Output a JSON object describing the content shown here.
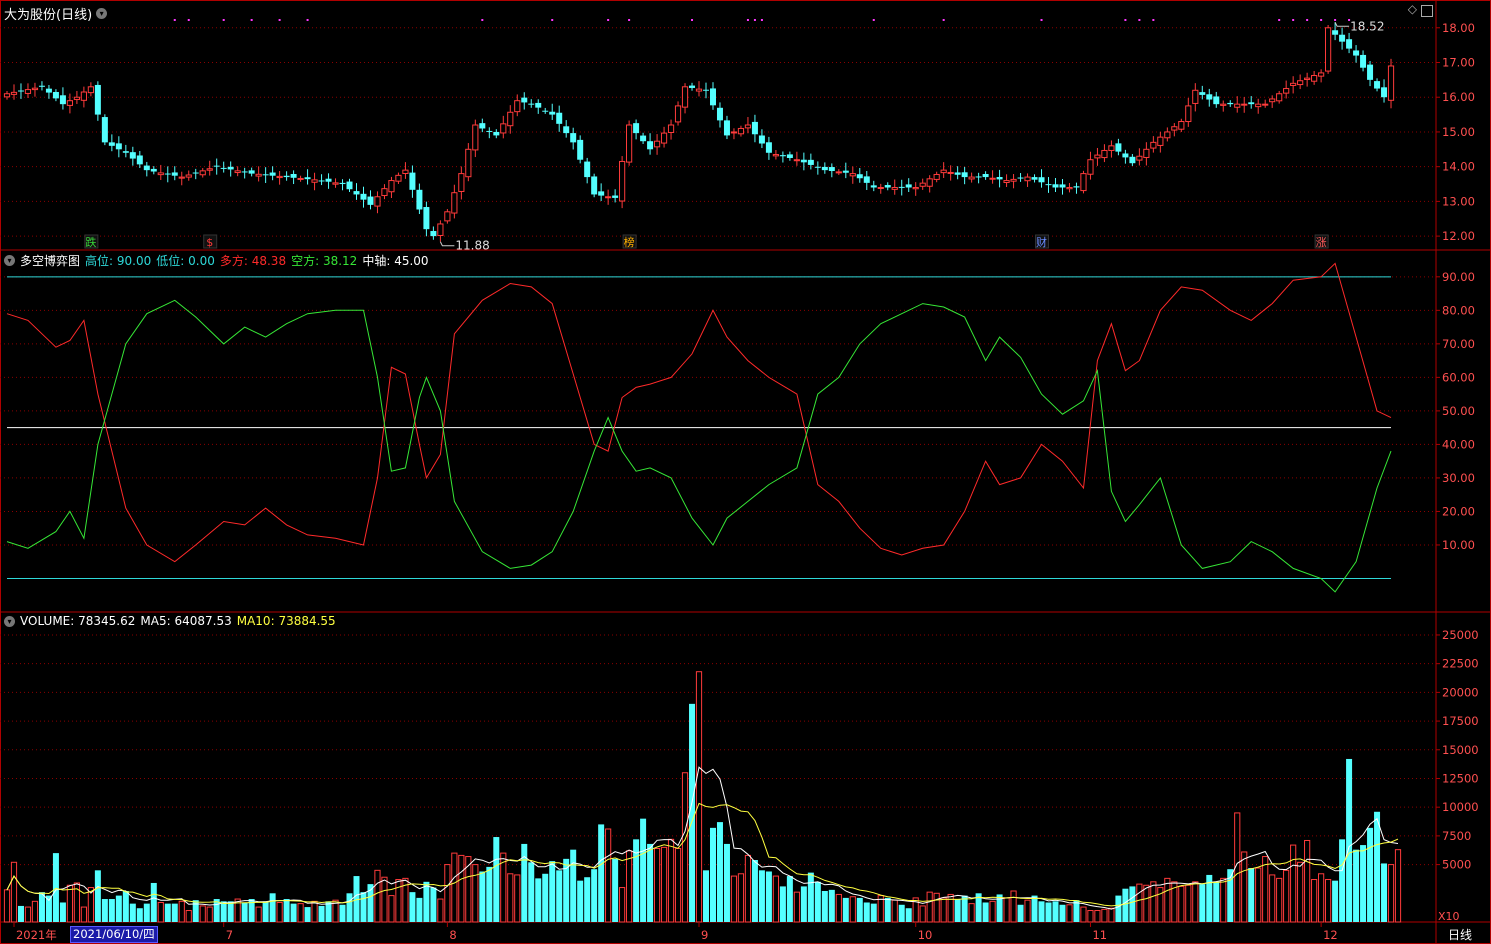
{
  "title": "大为股份(日线)",
  "colors": {
    "bg": "#000000",
    "frame": "#b00000",
    "up": "#ff3b3b",
    "down": "#54ffff",
    "grid": "#8a0000",
    "cyan": "#2ed9d9",
    "white": "#ffffff",
    "yellow": "#ffff40",
    "green": "#36e636",
    "red": "#ff2a2a",
    "magenta": "#ff36ff"
  },
  "price_panel": {
    "high_label": "18.52",
    "low_label": "11.88",
    "ticks": [
      "18.00",
      "17.00",
      "16.00",
      "15.00",
      "14.00",
      "13.00",
      "12.00"
    ],
    "markers": [
      {
        "text": "跌",
        "color": "#39d839",
        "bar": 12
      },
      {
        "text": "$",
        "color": "#ff3a3a",
        "bar": 29
      },
      {
        "text": "榜",
        "color": "#ffb000",
        "bar": 89
      },
      {
        "text": "财",
        "color": "#6a8cff",
        "bar": 148
      },
      {
        "text": "涨",
        "color": "#ff5a5a",
        "bar": 188
      }
    ]
  },
  "indicator_panel": {
    "name": "多空博弈图",
    "items": [
      {
        "label": "高位:",
        "value": "90.00",
        "color": "#2ed9d9"
      },
      {
        "label": "低位:",
        "value": "0.00",
        "color": "#2ed9d9"
      },
      {
        "label": "多方:",
        "value": "48.38",
        "color": "#ff2a2a"
      },
      {
        "label": "空方:",
        "value": "38.12",
        "color": "#36e636"
      },
      {
        "label": "中轴:",
        "value": "45.00",
        "color": "#ffffff"
      }
    ],
    "ticks": [
      "90.00",
      "80.00",
      "70.00",
      "60.00",
      "50.00",
      "40.00",
      "30.00",
      "20.00",
      "10.00"
    ]
  },
  "volume_panel": {
    "items": [
      {
        "label": "VOLUME:",
        "value": "78345.62",
        "color": "#ffffff"
      },
      {
        "label": "MA5:",
        "value": "64087.53",
        "color": "#ffffff"
      },
      {
        "label": "MA10:",
        "value": "73884.55",
        "color": "#ffff40"
      }
    ],
    "ticks": [
      "25000",
      "22500",
      "20000",
      "17500",
      "15000",
      "12500",
      "10000",
      "7500",
      "5000"
    ],
    "unit": "X10"
  },
  "xaxis": {
    "labels": [
      {
        "text": "2021年",
        "bar": 1
      },
      {
        "text": "7",
        "bar": 31
      },
      {
        "text": "8",
        "bar": 63
      },
      {
        "text": "9",
        "bar": 99
      },
      {
        "text": "10",
        "bar": 130
      },
      {
        "text": "11",
        "bar": 155
      },
      {
        "text": "12",
        "bar": 188
      }
    ],
    "cursor_date": "2021/06/10/四",
    "period": "日线"
  },
  "chart_data": [
    {
      "type": "candlestick",
      "title": "大为股份(日线)",
      "ylim": [
        11.6,
        18.8
      ],
      "anchors": [
        [
          0,
          16.1
        ],
        [
          5,
          16.3
        ],
        [
          8,
          15.8
        ],
        [
          10,
          16.0
        ],
        [
          12,
          16.3
        ],
        [
          14,
          14.7
        ],
        [
          17,
          14.4
        ],
        [
          20,
          13.9
        ],
        [
          25,
          13.7
        ],
        [
          30,
          14.0
        ],
        [
          35,
          13.8
        ],
        [
          40,
          13.7
        ],
        [
          45,
          13.6
        ],
        [
          48,
          13.5
        ],
        [
          52,
          12.9
        ],
        [
          55,
          13.6
        ],
        [
          57,
          13.9
        ],
        [
          60,
          12.2
        ],
        [
          61,
          12.0
        ],
        [
          63,
          12.7
        ],
        [
          65,
          13.8
        ],
        [
          67,
          15.2
        ],
        [
          70,
          14.9
        ],
        [
          73,
          15.9
        ],
        [
          75,
          15.8
        ],
        [
          78,
          15.5
        ],
        [
          81,
          14.7
        ],
        [
          84,
          13.2
        ],
        [
          87,
          13.1
        ],
        [
          89,
          15.2
        ],
        [
          92,
          14.5
        ],
        [
          95,
          15.2
        ],
        [
          97,
          16.3
        ],
        [
          100,
          16.2
        ],
        [
          103,
          14.9
        ],
        [
          106,
          15.2
        ],
        [
          109,
          14.4
        ],
        [
          113,
          14.2
        ],
        [
          117,
          13.9
        ],
        [
          121,
          13.8
        ],
        [
          124,
          13.4
        ],
        [
          127,
          13.4
        ],
        [
          130,
          13.4
        ],
        [
          134,
          13.9
        ],
        [
          137,
          13.7
        ],
        [
          140,
          13.7
        ],
        [
          143,
          13.6
        ],
        [
          146,
          13.7
        ],
        [
          150,
          13.4
        ],
        [
          153,
          13.4
        ],
        [
          155,
          14.2
        ],
        [
          158,
          14.6
        ],
        [
          161,
          14.1
        ],
        [
          164,
          14.7
        ],
        [
          168,
          15.3
        ],
        [
          170,
          16.2
        ],
        [
          173,
          15.8
        ],
        [
          176,
          15.8
        ],
        [
          180,
          15.8
        ],
        [
          184,
          16.4
        ],
        [
          188,
          16.7
        ],
        [
          189,
          18.0
        ],
        [
          191,
          17.6
        ],
        [
          193,
          17.2
        ],
        [
          195,
          16.5
        ],
        [
          197,
          16.0
        ],
        [
          198,
          16.9
        ]
      ]
    },
    {
      "type": "line",
      "title": "多空博弈图",
      "ylim": [
        -10,
        98
      ],
      "reference_lines": [
        90,
        0,
        45
      ],
      "x_bars": [
        0,
        198
      ],
      "series": [
        {
          "name": "多方",
          "color": "#ff2a2a",
          "points": [
            [
              0,
              79
            ],
            [
              3,
              77
            ],
            [
              7,
              69
            ],
            [
              9,
              71
            ],
            [
              11,
              77
            ],
            [
              13,
              55
            ],
            [
              17,
              21
            ],
            [
              20,
              10
            ],
            [
              24,
              5
            ],
            [
              27,
              10
            ],
            [
              31,
              17
            ],
            [
              34,
              16
            ],
            [
              37,
              21
            ],
            [
              40,
              16
            ],
            [
              43,
              13
            ],
            [
              47,
              12
            ],
            [
              51,
              10
            ],
            [
              53,
              30
            ],
            [
              55,
              63
            ],
            [
              57,
              61
            ],
            [
              59,
              40
            ],
            [
              60,
              30
            ],
            [
              62,
              37
            ],
            [
              64,
              73
            ],
            [
              68,
              83
            ],
            [
              72,
              88
            ],
            [
              75,
              87
            ],
            [
              78,
              82
            ],
            [
              81,
              61
            ],
            [
              84,
              40
            ],
            [
              86,
              38
            ],
            [
              88,
              54
            ],
            [
              90,
              57
            ],
            [
              92,
              58
            ],
            [
              95,
              60
            ],
            [
              98,
              67
            ],
            [
              101,
              80
            ],
            [
              103,
              72
            ],
            [
              106,
              65
            ],
            [
              109,
              60
            ],
            [
              113,
              55
            ],
            [
              116,
              28
            ],
            [
              119,
              23
            ],
            [
              122,
              15
            ],
            [
              125,
              9
            ],
            [
              128,
              7
            ],
            [
              131,
              9
            ],
            [
              134,
              10
            ],
            [
              137,
              20
            ],
            [
              140,
              35
            ],
            [
              142,
              28
            ],
            [
              145,
              30
            ],
            [
              148,
              40
            ],
            [
              151,
              35
            ],
            [
              154,
              27
            ],
            [
              156,
              65
            ],
            [
              158,
              76
            ],
            [
              160,
              62
            ],
            [
              162,
              65
            ],
            [
              165,
              80
            ],
            [
              168,
              87
            ],
            [
              171,
              86
            ],
            [
              175,
              80
            ],
            [
              178,
              77
            ],
            [
              181,
              82
            ],
            [
              184,
              89
            ],
            [
              188,
              90
            ],
            [
              190,
              94
            ],
            [
              193,
              72
            ],
            [
              196,
              50
            ],
            [
              198,
              48
            ]
          ]
        },
        {
          "name": "空方",
          "color": "#36e636",
          "points": [
            [
              0,
              11
            ],
            [
              3,
              9
            ],
            [
              7,
              14
            ],
            [
              9,
              20
            ],
            [
              11,
              12
            ],
            [
              13,
              40
            ],
            [
              17,
              70
            ],
            [
              20,
              79
            ],
            [
              24,
              83
            ],
            [
              27,
              78
            ],
            [
              31,
              70
            ],
            [
              34,
              75
            ],
            [
              37,
              72
            ],
            [
              40,
              76
            ],
            [
              43,
              79
            ],
            [
              47,
              80
            ],
            [
              51,
              80
            ],
            [
              53,
              60
            ],
            [
              55,
              32
            ],
            [
              57,
              33
            ],
            [
              59,
              54
            ],
            [
              60,
              60
            ],
            [
              62,
              50
            ],
            [
              64,
              23
            ],
            [
              68,
              8
            ],
            [
              72,
              3
            ],
            [
              75,
              4
            ],
            [
              78,
              8
            ],
            [
              81,
              20
            ],
            [
              84,
              38
            ],
            [
              86,
              48
            ],
            [
              88,
              38
            ],
            [
              90,
              32
            ],
            [
              92,
              33
            ],
            [
              95,
              30
            ],
            [
              98,
              18
            ],
            [
              101,
              10
            ],
            [
              103,
              18
            ],
            [
              106,
              23
            ],
            [
              109,
              28
            ],
            [
              113,
              33
            ],
            [
              116,
              55
            ],
            [
              119,
              60
            ],
            [
              122,
              70
            ],
            [
              125,
              76
            ],
            [
              128,
              79
            ],
            [
              131,
              82
            ],
            [
              134,
              81
            ],
            [
              137,
              78
            ],
            [
              140,
              65
            ],
            [
              142,
              72
            ],
            [
              145,
              66
            ],
            [
              148,
              55
            ],
            [
              151,
              49
            ],
            [
              154,
              53
            ],
            [
              156,
              62
            ],
            [
              158,
              26
            ],
            [
              160,
              17
            ],
            [
              162,
              22
            ],
            [
              165,
              30
            ],
            [
              168,
              10
            ],
            [
              171,
              3
            ],
            [
              175,
              5
            ],
            [
              178,
              11
            ],
            [
              181,
              8
            ],
            [
              184,
              3
            ],
            [
              188,
              0
            ],
            [
              190,
              -4
            ],
            [
              193,
              5
            ],
            [
              196,
              27
            ],
            [
              198,
              38
            ]
          ]
        }
      ]
    },
    {
      "type": "bar",
      "title": "VOLUME",
      "ylim": [
        0,
        27000
      ],
      "values": [
        2800,
        5200,
        1400,
        1300,
        1800,
        2600,
        2300,
        6000,
        1700,
        3200,
        3400,
        1300,
        3000,
        4500,
        2000,
        2000,
        2300,
        2700,
        1600,
        1200,
        1600,
        3400,
        1700,
        1600,
        1600,
        1800,
        1000,
        1900,
        1400,
        1300,
        2000,
        1800,
        1800,
        2000,
        1700,
        2000,
        1300,
        1800,
        2500,
        1700,
        2000,
        1600,
        1600,
        1300,
        1800,
        1400,
        1800,
        1900,
        1500,
        2500,
        4000,
        2600,
        3300,
        4500,
        3900,
        2300,
        3700,
        3800,
        2600,
        2100,
        3500,
        3000,
        2000,
        5000,
        6000,
        5800,
        5700,
        5000,
        4400,
        4800,
        7400,
        6000,
        4200,
        4100,
        6800,
        5200,
        3800,
        4200,
        5300,
        4500,
        5500,
        6300,
        3600,
        3900,
        4600,
        8500,
        8100,
        5500,
        3000,
        6200,
        7200,
        9000,
        6800,
        6400,
        6500,
        7200,
        6400,
        13000,
        19000,
        21800,
        4500,
        8200,
        8700,
        6800,
        4000,
        4200,
        5800,
        5400,
        4500,
        4400,
        4000,
        3100,
        4000,
        2600,
        3100,
        4300,
        3500,
        2700,
        2800,
        2400,
        2100,
        2200,
        2100,
        1700,
        1600,
        2300,
        2100,
        1900,
        1500,
        1200,
        2100,
        1400,
        2600,
        2500,
        2100,
        2400,
        2000,
        2300,
        1600,
        2500,
        1700,
        1800,
        2400,
        2100,
        2700,
        1500,
        1900,
        2300,
        1800,
        1700,
        1800,
        1500,
        1500,
        1900,
        1300,
        1000,
        1000,
        1100,
        1200,
        2300,
        2900,
        3100,
        3300,
        3200,
        3500,
        3000,
        3800,
        3500,
        3100,
        3200,
        3500,
        3300,
        4100,
        3500,
        3800,
        4600,
        9500,
        6100,
        4700,
        4700,
        5700,
        4100,
        3800,
        4500,
        6700,
        5200,
        7100,
        3700,
        4200,
        3700,
        3600,
        7200,
        14200,
        6300,
        6700,
        8200,
        9600,
        5100,
        5000,
        6300
      ]
    }
  ]
}
